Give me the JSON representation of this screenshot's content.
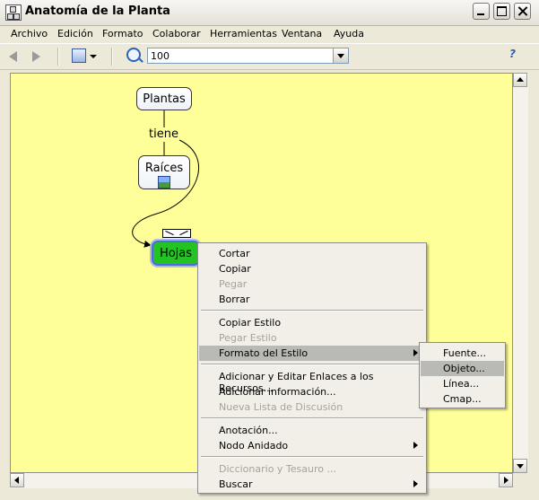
{
  "window": {
    "title": "Anatomía de la Planta"
  },
  "menubar": [
    "Archivo",
    "Edición",
    "Formato",
    "Colaborar",
    "Herramientas",
    "Ventana",
    "Ayuda"
  ],
  "toolbar": {
    "zoom_value": "100"
  },
  "concept_map": {
    "nodes": {
      "plantas": "Plantas",
      "raices": "Raíces",
      "hojas": "Hojas"
    },
    "linking_phrase": "tiene",
    "colors": {
      "canvas": "#FFFF99",
      "hojas_fill": "#22C322",
      "selection": "#4D6FD3"
    }
  },
  "context_menu": {
    "items": [
      {
        "label": "Cortar",
        "disabled": false
      },
      {
        "label": "Copiar",
        "disabled": false
      },
      {
        "label": "Pegar",
        "disabled": true
      },
      {
        "label": "Borrar",
        "disabled": false
      },
      {
        "label": "Copiar Estilo",
        "disabled": false
      },
      {
        "label": "Pegar Estilo",
        "disabled": true
      },
      {
        "label": "Formato del Estilo",
        "disabled": false,
        "submenu": true,
        "highlighted": true
      },
      {
        "label": "Adicionar y Editar Enlaces a los Recursos...",
        "disabled": false
      },
      {
        "label": "Adicionar información...",
        "disabled": false
      },
      {
        "label": "Nueva Lista de Discusión",
        "disabled": true
      },
      {
        "label": "Anotación...",
        "disabled": false
      },
      {
        "label": "Nodo Anidado",
        "disabled": false,
        "submenu": true
      },
      {
        "label": "Diccionario y Tesauro ...",
        "disabled": true
      },
      {
        "label": "Buscar",
        "disabled": false,
        "submenu": true
      }
    ]
  },
  "submenu": {
    "items": [
      {
        "label": "Fuente...",
        "highlighted": false
      },
      {
        "label": "Objeto...",
        "highlighted": true
      },
      {
        "label": "Línea...",
        "highlighted": false
      },
      {
        "label": "Cmap...",
        "highlighted": false
      }
    ]
  }
}
